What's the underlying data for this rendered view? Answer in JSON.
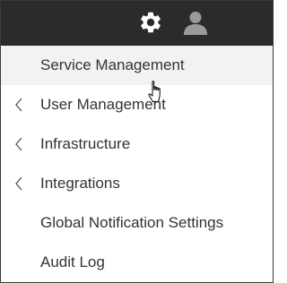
{
  "topbar": {
    "icons": [
      "gear-icon",
      "user-icon"
    ],
    "background": "#2b2b2b",
    "icon_color": "#ffffff",
    "user_icon_color": "#9a9a9a"
  },
  "menu": {
    "items": [
      {
        "label": "Service Management",
        "has_submenu": false,
        "highlighted": true
      },
      {
        "label": "User Management",
        "has_submenu": true
      },
      {
        "label": "Infrastructure",
        "has_submenu": true
      },
      {
        "label": "Integrations",
        "has_submenu": true
      },
      {
        "label": "Global Notification Settings",
        "has_submenu": false
      },
      {
        "label": "Audit Log",
        "has_submenu": false
      }
    ],
    "hover_background": "#f2f2f2",
    "text_color": "#333333"
  }
}
